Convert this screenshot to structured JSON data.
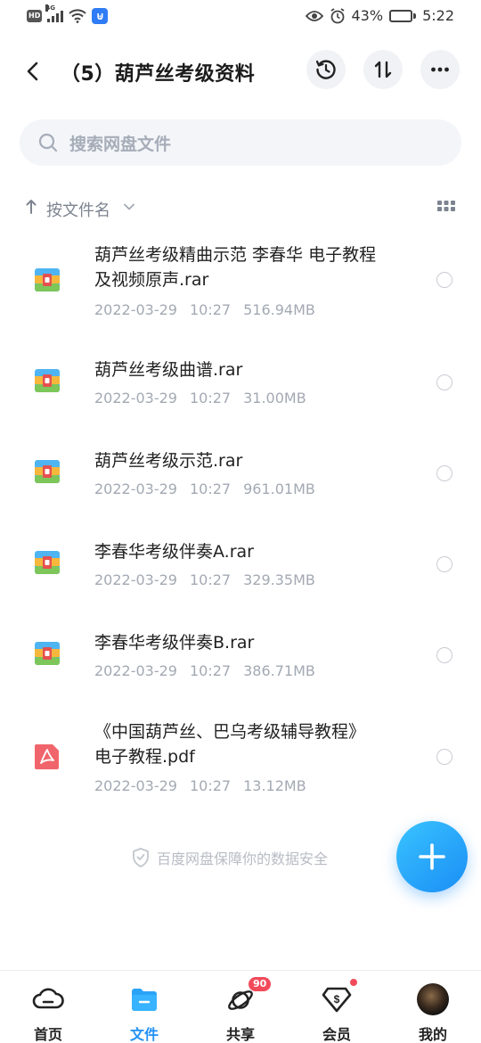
{
  "status_bar": {
    "hd": "HD",
    "network": "4G",
    "battery_percent": "43%",
    "battery_level": 0.43,
    "time": "5:22"
  },
  "header": {
    "title": "（5）葫芦丝考级资料",
    "icons": [
      "back-arrow-icon",
      "history-icon",
      "sort-toggle-icon",
      "more-icon"
    ]
  },
  "search": {
    "placeholder": "搜索网盘文件"
  },
  "sort": {
    "label": "按文件名"
  },
  "files": [
    {
      "name_line1": "葫芦丝考级精曲示范 李春华 电子教程",
      "name_line2": "及视频原声.rar",
      "date": "2022-03-29",
      "time": "10:27",
      "size": "516.94MB",
      "type": "rar"
    },
    {
      "name_line1": "葫芦丝考级曲谱.rar",
      "name_line2": "",
      "date": "2022-03-29",
      "time": "10:27",
      "size": "31.00MB",
      "type": "rar"
    },
    {
      "name_line1": "葫芦丝考级示范.rar",
      "name_line2": "",
      "date": "2022-03-29",
      "time": "10:27",
      "size": "961.01MB",
      "type": "rar"
    },
    {
      "name_line1": "李春华考级伴奏A.rar",
      "name_line2": "",
      "date": "2022-03-29",
      "time": "10:27",
      "size": "329.35MB",
      "type": "rar"
    },
    {
      "name_line1": "李春华考级伴奏B.rar",
      "name_line2": "",
      "date": "2022-03-29",
      "time": "10:27",
      "size": "386.71MB",
      "type": "rar"
    },
    {
      "name_line1": "《中国葫芦丝、巴乌考级辅导教程》",
      "name_line2": "电子教程.pdf",
      "date": "2022-03-29",
      "time": "10:27",
      "size": "13.12MB",
      "type": "pdf"
    }
  ],
  "secure_note": "百度网盘保障你的数据安全",
  "bottom_nav": {
    "items": [
      {
        "label": "首页",
        "icon": "home-cloud-icon"
      },
      {
        "label": "文件",
        "icon": "folder-icon"
      },
      {
        "label": "共享",
        "icon": "share-planet-icon",
        "badge": "90"
      },
      {
        "label": "会员",
        "icon": "vip-dollar-icon"
      },
      {
        "label": "我的",
        "icon": "avatar"
      }
    ]
  },
  "colors": {
    "accent": "#2391f5",
    "badge": "#f24a5b",
    "muted_text": "#a3a9b3"
  }
}
